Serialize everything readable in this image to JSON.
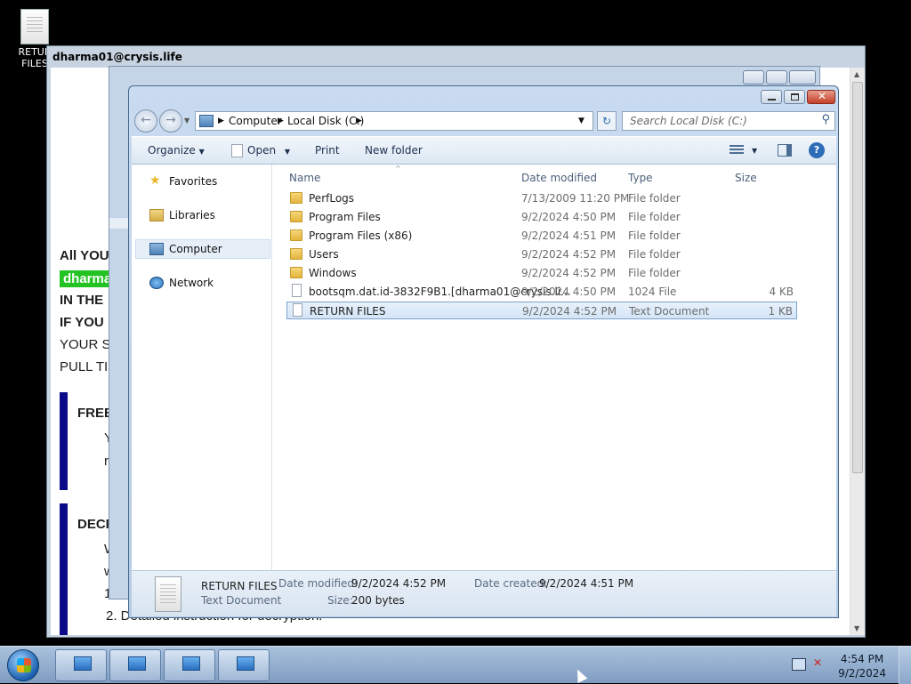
{
  "desktop": {
    "icon_label_line1": "RETUR",
    "icon_label_line2": "FILES"
  },
  "note": {
    "title": "dharma01@crysis.life",
    "lines": [
      "All YOU",
      "dharma",
      "IN THE",
      "IF YOU",
      "YOUR S",
      "PULL TI"
    ],
    "free_head": "FREE",
    "free_text_1": "Y",
    "free_text_2": "r",
    "decr_head": "DECR",
    "decr_text_1": "W",
    "decr_text_2": "w",
    "decr_text_3": "1",
    "decr_step_2": "2. Detailed instruction for decryption."
  },
  "explorer": {
    "breadcrumb": [
      "Computer",
      "Local Disk (C:)"
    ],
    "search_placeholder": "Search Local Disk (C:)",
    "toolbar": {
      "organize": "Organize",
      "open": "Open",
      "print": "Print",
      "new_folder": "New folder"
    },
    "nav": [
      "Favorites",
      "Libraries",
      "Computer",
      "Network"
    ],
    "columns": [
      "Name",
      "Date modified",
      "Type",
      "Size"
    ],
    "files": [
      {
        "name": "PerfLogs",
        "date": "7/13/2009 11:20 PM",
        "type": "File folder",
        "size": "",
        "kind": "folder"
      },
      {
        "name": "Program Files",
        "date": "9/2/2024 4:50 PM",
        "type": "File folder",
        "size": "",
        "kind": "folder"
      },
      {
        "name": "Program Files (x86)",
        "date": "9/2/2024 4:51 PM",
        "type": "File folder",
        "size": "",
        "kind": "folder"
      },
      {
        "name": "Users",
        "date": "9/2/2024 4:52 PM",
        "type": "File folder",
        "size": "",
        "kind": "folder"
      },
      {
        "name": "Windows",
        "date": "9/2/2024 4:52 PM",
        "type": "File folder",
        "size": "",
        "kind": "folder"
      },
      {
        "name": "bootsqm.dat.id-3832F9B1.[dharma01@crysis.li...",
        "date": "9/2/2024 4:50 PM",
        "type": "1024 File",
        "size": "4 KB",
        "kind": "file"
      },
      {
        "name": "RETURN FILES",
        "date": "9/2/2024 4:52 PM",
        "type": "Text Document",
        "size": "1 KB",
        "kind": "file",
        "selected": true
      }
    ],
    "details": {
      "name": "RETURN FILES",
      "type": "Text Document",
      "date_modified_label": "Date modified:",
      "date_modified": "9/2/2024 4:52 PM",
      "size_label": "Size:",
      "size": "200 bytes",
      "date_created_label": "Date created:",
      "date_created": "9/2/2024 4:51 PM"
    }
  },
  "taskbar": {
    "time": "4:54 PM",
    "date": "9/2/2024"
  }
}
